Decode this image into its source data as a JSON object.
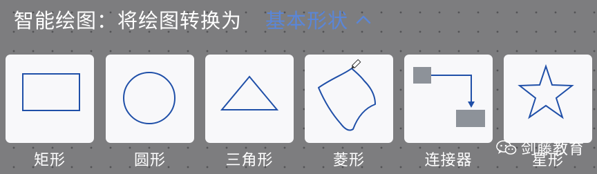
{
  "header": {
    "title": "智能绘图：将绘图转换为",
    "shape_type": "基本形状",
    "chevron_icon": "chevron-up-icon"
  },
  "shapes": [
    {
      "label": "矩形",
      "icon": "rectangle-icon"
    },
    {
      "label": "圆形",
      "icon": "circle-icon"
    },
    {
      "label": "三角形",
      "icon": "triangle-icon"
    },
    {
      "label": "菱形",
      "icon": "diamond-sketch-icon"
    },
    {
      "label": "连接器",
      "icon": "connector-icon"
    },
    {
      "label": "星形",
      "icon": "star-icon"
    }
  ],
  "watermark": {
    "text": "剑藤教育",
    "icon": "wechat-icon"
  },
  "colors": {
    "background": "#7d7d7f",
    "card": "#f8f8fa",
    "stroke": "#1f4fa8",
    "accent": "#5a86d8",
    "connector_box": "#8d9299"
  }
}
